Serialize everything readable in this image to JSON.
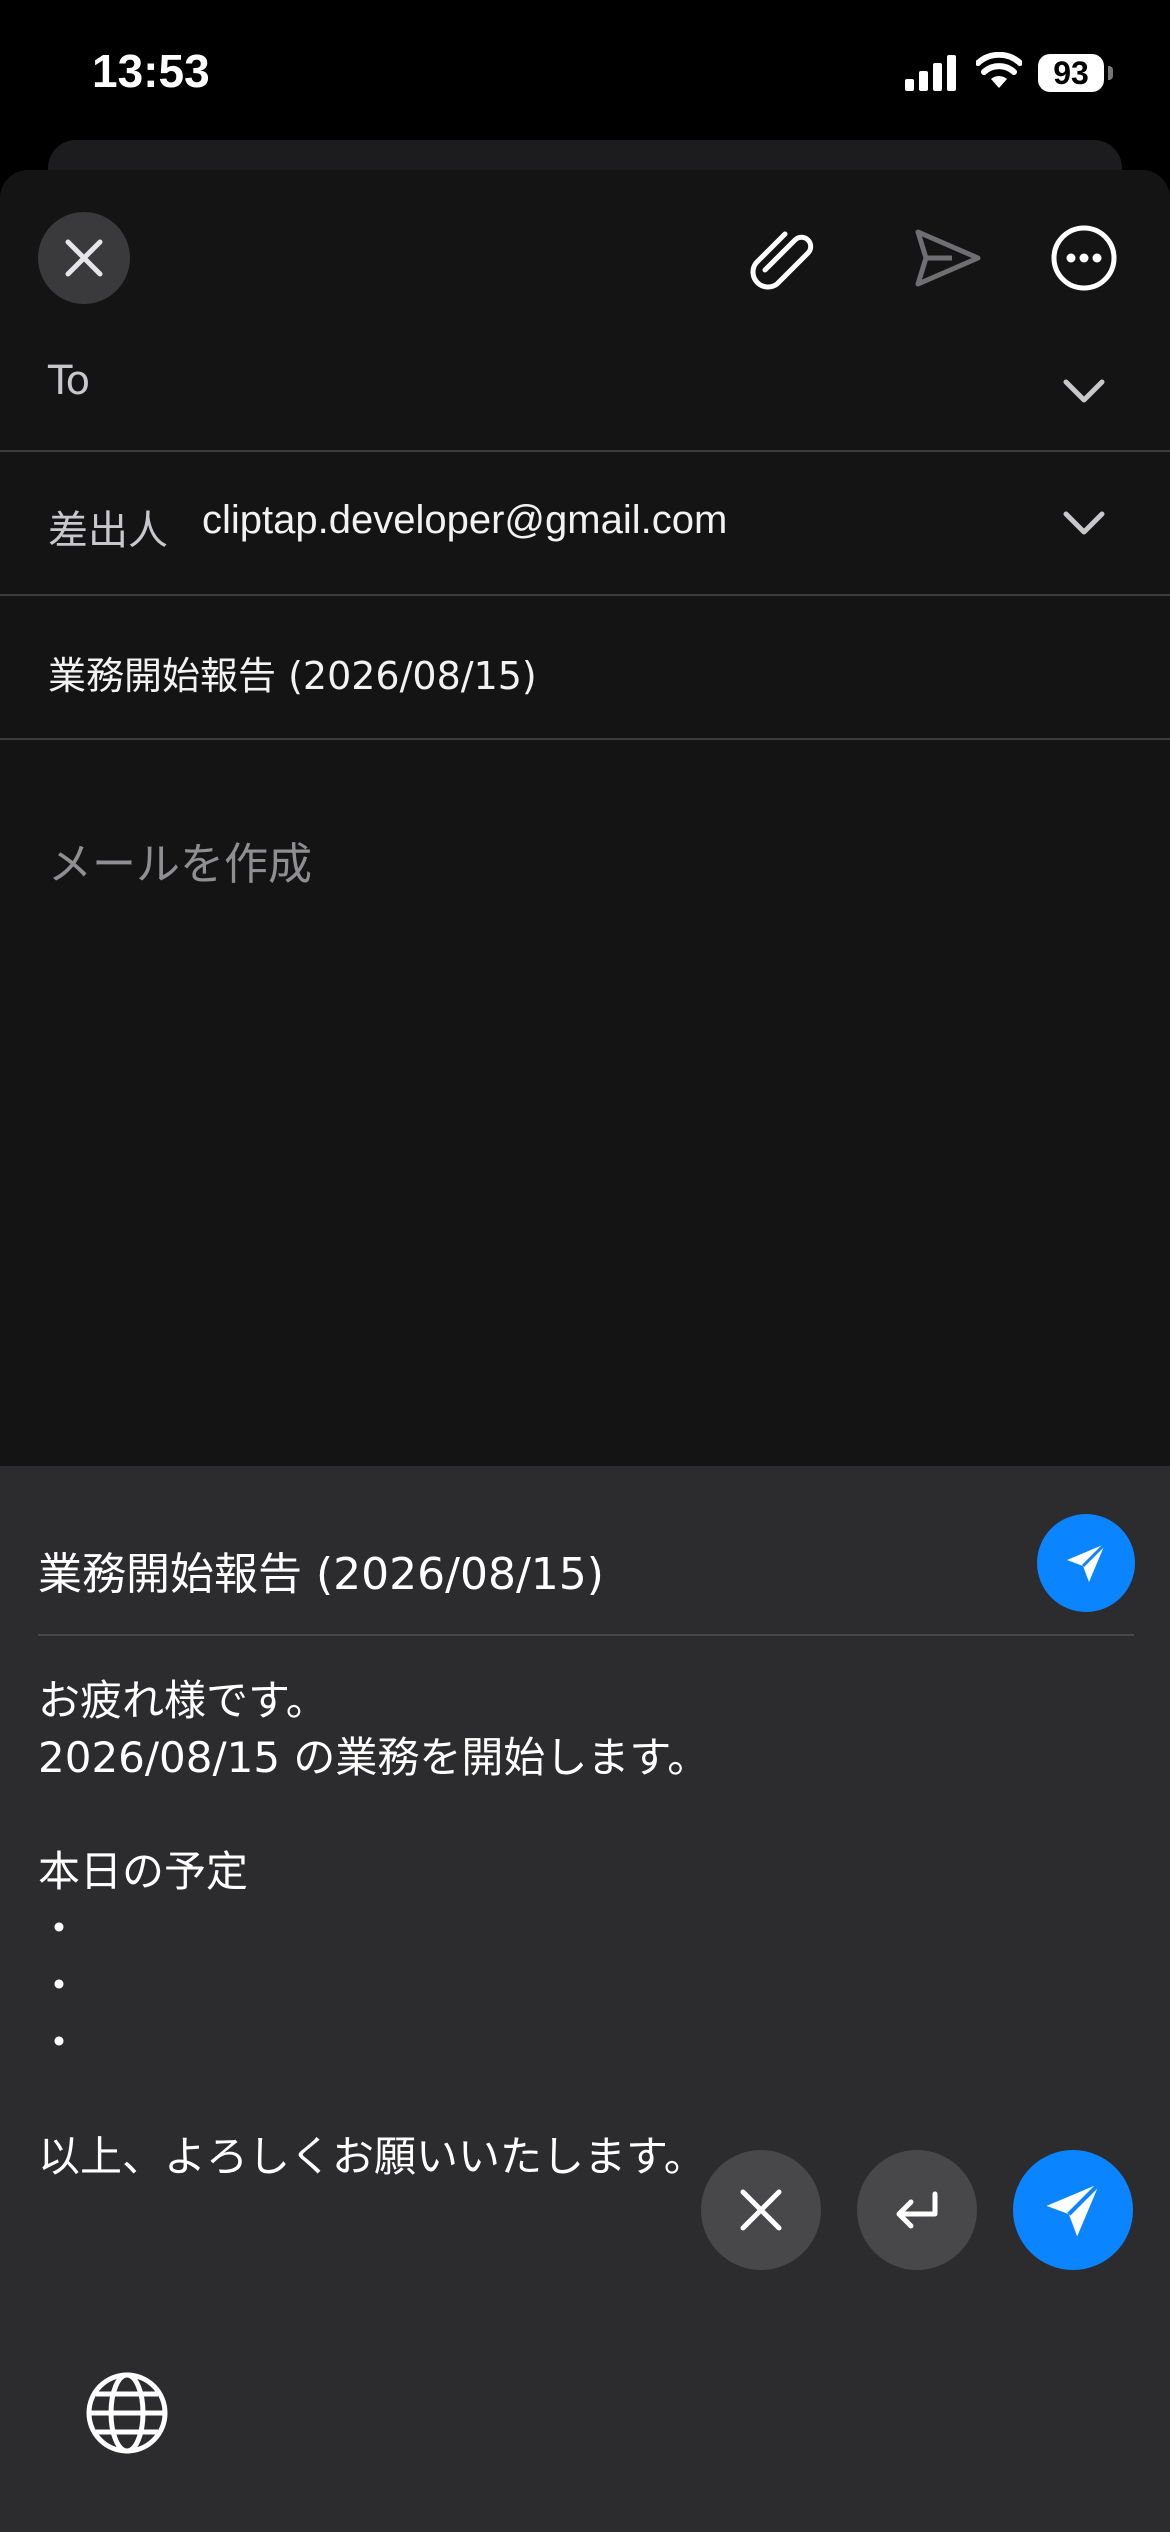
{
  "status_bar": {
    "time": "13:53",
    "battery": "93"
  },
  "compose": {
    "to_label": "To",
    "from_label": "差出人",
    "from_value": "cliptap.developer@gmail.com",
    "subject": "業務開始報告 (2026/08/15)",
    "body_placeholder": "メールを作成"
  },
  "panel": {
    "title": "業務開始報告 (2026/08/15)",
    "body": "お疲れ様です。\n2026/08/15 の業務を開始します。\n\n本日の予定\n・\n・\n・\n\n以上、よろしくお願いいたします。"
  },
  "colors": {
    "accent": "#0a84ff",
    "background": "#141414",
    "panel": "#2c2c2e"
  },
  "icons": {
    "close": "close-icon",
    "attach": "paperclip-icon",
    "send": "send-icon",
    "more": "more-icon",
    "chevron": "chevron-down-icon",
    "return": "return-icon",
    "globe": "globe-icon"
  }
}
